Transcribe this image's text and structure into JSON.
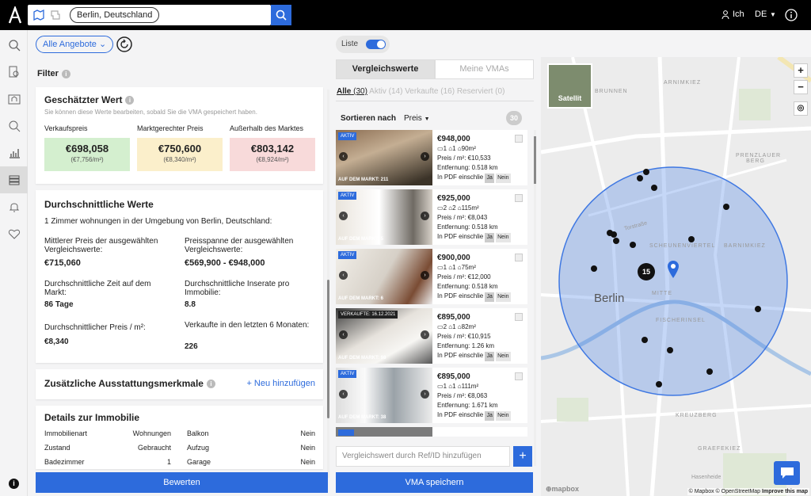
{
  "topbar": {
    "search_value": "Berlin, Deutschland",
    "user_label": "Ich",
    "lang_label": "DE"
  },
  "left": {
    "filter_pill": "Alle Angebote",
    "filter_label": "Filter",
    "estimated": {
      "title": "Geschätzter Wert",
      "note": "Sie können diese Werte bearbeiten, sobald Sie die VMA gespeichert haben.",
      "cols": [
        {
          "label": "Verkaufspreis",
          "value": "€698,058",
          "sub": "(€7,756/m²)",
          "color": "#d4efcf"
        },
        {
          "label": "Marktgerechter Preis",
          "value": "€750,600",
          "sub": "(€8,340/m²)",
          "color": "#fbefcb"
        },
        {
          "label": "Außerhalb des Marktes",
          "value": "€803,142",
          "sub": "(€8,924/m²)",
          "color": "#f8dada"
        }
      ]
    },
    "avg": {
      "title": "Durchschnittliche Werte",
      "subtitle": "1 Zimmer wohnungen in der Umgebung von Berlin, Deutschland:",
      "items": [
        {
          "label": "Mittlerer Preis der ausgewählten Vergleichswerte:",
          "value": "€715,060"
        },
        {
          "label": "Preisspanne der ausgewählten Vergleichswerte:",
          "value": "€569,900 - €948,000"
        },
        {
          "label": "Durchschnittliche Zeit auf dem Markt:",
          "value": "86 Tage"
        },
        {
          "label": "Durchschnittliche Inserate pro Immobilie:",
          "value": "8.8"
        },
        {
          "label": "Durchschnittlicher Preis / m²:",
          "value": "€8,340"
        },
        {
          "label": "Verkaufte in den letzten 6 Monaten:",
          "value": "226"
        }
      ]
    },
    "features": {
      "title": "Zusätzliche Ausstattungsmerkmale",
      "add": "+ Neu hinzufügen"
    },
    "details": {
      "title": "Details zur Immobilie",
      "rows": [
        {
          "k1": "Immobilienart",
          "v1": "Wohnungen",
          "k2": "Balkon",
          "v2": "Nein"
        },
        {
          "k1": "Zustand",
          "v1": "Gebraucht",
          "k2": "Aufzug",
          "v2": "Nein"
        },
        {
          "k1": "Badezimmer",
          "v1": "1",
          "k2": "Garage",
          "v2": "Nein"
        }
      ]
    },
    "bewerten": "Bewerten"
  },
  "mid": {
    "liste": "Liste",
    "tab1": "Vergleichswerte",
    "tab2": "Meine VMAs",
    "subtabs": {
      "alle": "Alle",
      "alle_n": "(30)",
      "aktiv": "Aktiv",
      "aktiv_n": "(14)",
      "verkaufte": "Verkaufte",
      "verkaufte_n": "(16)",
      "reserviert": "Reserviert",
      "reserviert_n": "(0)"
    },
    "sort_label": "Sortieren nach",
    "sort_value": "Preis",
    "count": "30",
    "items": [
      {
        "badge": "AKTIV",
        "foot": "AUF DEM MARKT: 211",
        "price": "€948,000",
        "rooms": "1",
        "baths": "1",
        "area": "90m²",
        "ppm": "Preis / m²: €10,533",
        "dist": "Entfernung: 0.518 km"
      },
      {
        "badge": "AKTIV",
        "foot": "AUF DEM MARKT: 5",
        "price": "€925,000",
        "rooms": "2",
        "baths": "2",
        "area": "115m²",
        "ppm": "Preis / m²: €8,043",
        "dist": "Entfernung: 0.518 km"
      },
      {
        "badge": "AKTIV",
        "foot": "AUF DEM MARKT: 6",
        "price": "€900,000",
        "rooms": "1",
        "baths": "1",
        "area": "75m²",
        "ppm": "Preis / m²: €12,000",
        "dist": "Entfernung: 0.518 km"
      },
      {
        "badge": "VERKAUFTE: 16.12.2021",
        "foot": "AUF DEM MARKT: 98",
        "price": "€895,000",
        "rooms": "2",
        "baths": "1",
        "area": "82m²",
        "ppm": "Preis / m²: €10,915",
        "dist": "Entfernung: 1.26 km"
      },
      {
        "badge": "AKTIV",
        "foot": "AUF DEM MARKT: 38",
        "price": "€895,000",
        "rooms": "1",
        "baths": "1",
        "area": "111m²",
        "ppm": "Preis / m²: €8,063",
        "dist": "Entfernung: 1.671 km"
      }
    ],
    "pdf_label": "In PDF einschlie",
    "ja": "Ja",
    "nein": "Nein",
    "add_placeholder": "Vergleichswert durch Ref/ID hinzufügen",
    "save": "VMA speichern"
  },
  "map": {
    "satellite": "Satellit",
    "cluster": "15",
    "labels": {
      "berlin": "Berlin",
      "brunnen": "BRUNNEN",
      "arnimkiez": "ARNIMKIEZ",
      "prenz": "PRENZLAUER BERG",
      "scheunen": "SCHEUNENVIERTEL",
      "barnim": "BARNIMKIEZ",
      "mitte": "MITTE",
      "fischer": "FISCHERINSEL",
      "kreuz": "KREUZBERG",
      "graefe": "GRAEFEKIEZ",
      "torstr": "Torstraße",
      "hasen": "Hasenheide"
    },
    "attribution": "© Mapbox © OpenStreetMap",
    "improve": "Improve this map",
    "mapbox": "mapbox"
  }
}
